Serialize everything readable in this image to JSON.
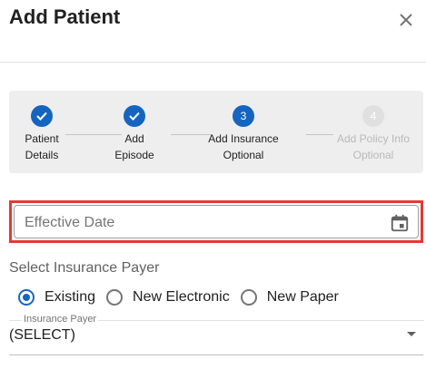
{
  "dialog": {
    "title": "Add Patient"
  },
  "stepper": {
    "steps": [
      {
        "label_line1": "Patient",
        "label_line2": "Details",
        "state": "done"
      },
      {
        "label_line1": "Add",
        "label_line2": "Episode",
        "state": "done"
      },
      {
        "label_line1": "Add Insurance",
        "label_line2": "Optional",
        "state": "active",
        "number": "3"
      },
      {
        "label_line1": "Add Policy Info",
        "label_line2": "Optional",
        "state": "inactive",
        "number": "4"
      }
    ]
  },
  "effective_date": {
    "placeholder": "Effective Date"
  },
  "payer": {
    "heading": "Select Insurance Payer",
    "options": [
      "Existing",
      "New Electronic",
      "New Paper"
    ],
    "selected": "Existing",
    "select_label": "Insurance Payer",
    "select_value": "(SELECT)"
  },
  "colors": {
    "accent": "#1565c0",
    "highlight": "#e53935"
  }
}
